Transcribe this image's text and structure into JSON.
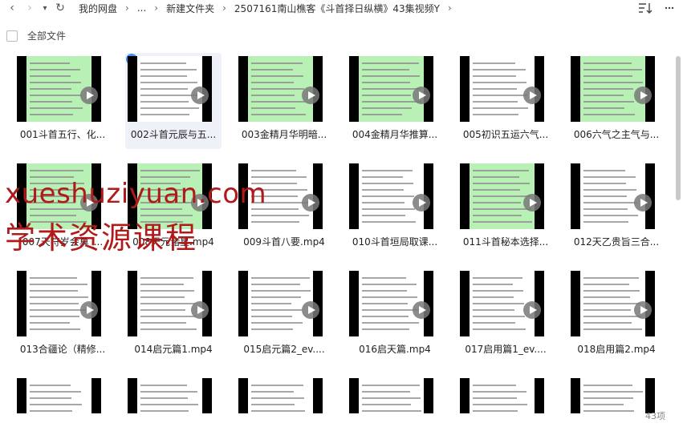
{
  "nav": {
    "back": "‹",
    "forward": "›",
    "dropdown": "▾",
    "refresh": "↻"
  },
  "breadcrumb": [
    "我的网盘",
    "...",
    "新建文件夹",
    "2507161南山樵客《斗首择日纵横》43集视频Y"
  ],
  "breadcrumb_sep": "›",
  "select_all": "全部文件",
  "files": [
    {
      "name": "001斗首五行、化...",
      "style": "green"
    },
    {
      "name": "002斗首元辰与五...",
      "style": "white",
      "selected": true
    },
    {
      "name": "003金精月华明暗...",
      "style": "green"
    },
    {
      "name": "004金精月华推算...",
      "style": "green"
    },
    {
      "name": "005初识五运六气...",
      "style": "white"
    },
    {
      "name": "006六气之主气与...",
      "style": "green"
    },
    {
      "name": "007天符岁会算_...",
      "style": "green"
    },
    {
      "name": "008天元诸星.mp4",
      "style": "green"
    },
    {
      "name": "009斗首八要.mp4",
      "style": "white"
    },
    {
      "name": "010斗首垣局取课...",
      "style": "white"
    },
    {
      "name": "011斗首秘本选择...",
      "style": "green"
    },
    {
      "name": "012天乙贵旨三合...",
      "style": "white"
    },
    {
      "name": "013合疆论（精修...",
      "style": "white"
    },
    {
      "name": "014启元篇1.mp4",
      "style": "white"
    },
    {
      "name": "015启元篇2_ev....",
      "style": "white"
    },
    {
      "name": "016启天篇.mp4",
      "style": "white"
    },
    {
      "name": "017启用篇1_ev....",
      "style": "white"
    },
    {
      "name": "018启用篇2.mp4",
      "style": "white"
    },
    {
      "name": "",
      "style": "white"
    },
    {
      "name": "",
      "style": "white"
    },
    {
      "name": "",
      "style": "white"
    },
    {
      "name": "",
      "style": "white"
    },
    {
      "name": "",
      "style": "white"
    },
    {
      "name": "",
      "style": "white"
    }
  ],
  "watermark": {
    "line1": "xueshuziyuan.com",
    "line2": "学术资源课程"
  },
  "item_count": "43项"
}
